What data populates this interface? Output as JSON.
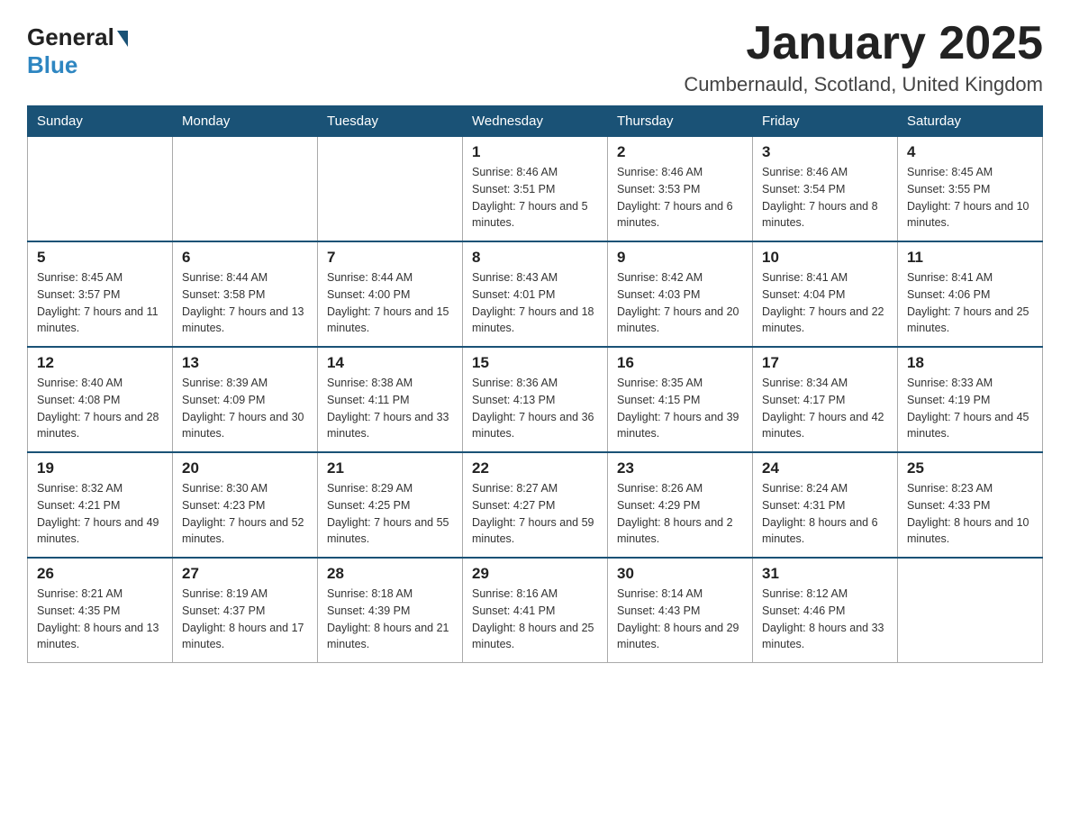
{
  "header": {
    "logo_general": "General",
    "logo_blue": "Blue",
    "month_title": "January 2025",
    "location": "Cumbernauld, Scotland, United Kingdom"
  },
  "weekdays": [
    "Sunday",
    "Monday",
    "Tuesday",
    "Wednesday",
    "Thursday",
    "Friday",
    "Saturday"
  ],
  "weeks": [
    [
      {
        "day": "",
        "info": ""
      },
      {
        "day": "",
        "info": ""
      },
      {
        "day": "",
        "info": ""
      },
      {
        "day": "1",
        "info": "Sunrise: 8:46 AM\nSunset: 3:51 PM\nDaylight: 7 hours and 5 minutes."
      },
      {
        "day": "2",
        "info": "Sunrise: 8:46 AM\nSunset: 3:53 PM\nDaylight: 7 hours and 6 minutes."
      },
      {
        "day": "3",
        "info": "Sunrise: 8:46 AM\nSunset: 3:54 PM\nDaylight: 7 hours and 8 minutes."
      },
      {
        "day": "4",
        "info": "Sunrise: 8:45 AM\nSunset: 3:55 PM\nDaylight: 7 hours and 10 minutes."
      }
    ],
    [
      {
        "day": "5",
        "info": "Sunrise: 8:45 AM\nSunset: 3:57 PM\nDaylight: 7 hours and 11 minutes."
      },
      {
        "day": "6",
        "info": "Sunrise: 8:44 AM\nSunset: 3:58 PM\nDaylight: 7 hours and 13 minutes."
      },
      {
        "day": "7",
        "info": "Sunrise: 8:44 AM\nSunset: 4:00 PM\nDaylight: 7 hours and 15 minutes."
      },
      {
        "day": "8",
        "info": "Sunrise: 8:43 AM\nSunset: 4:01 PM\nDaylight: 7 hours and 18 minutes."
      },
      {
        "day": "9",
        "info": "Sunrise: 8:42 AM\nSunset: 4:03 PM\nDaylight: 7 hours and 20 minutes."
      },
      {
        "day": "10",
        "info": "Sunrise: 8:41 AM\nSunset: 4:04 PM\nDaylight: 7 hours and 22 minutes."
      },
      {
        "day": "11",
        "info": "Sunrise: 8:41 AM\nSunset: 4:06 PM\nDaylight: 7 hours and 25 minutes."
      }
    ],
    [
      {
        "day": "12",
        "info": "Sunrise: 8:40 AM\nSunset: 4:08 PM\nDaylight: 7 hours and 28 minutes."
      },
      {
        "day": "13",
        "info": "Sunrise: 8:39 AM\nSunset: 4:09 PM\nDaylight: 7 hours and 30 minutes."
      },
      {
        "day": "14",
        "info": "Sunrise: 8:38 AM\nSunset: 4:11 PM\nDaylight: 7 hours and 33 minutes."
      },
      {
        "day": "15",
        "info": "Sunrise: 8:36 AM\nSunset: 4:13 PM\nDaylight: 7 hours and 36 minutes."
      },
      {
        "day": "16",
        "info": "Sunrise: 8:35 AM\nSunset: 4:15 PM\nDaylight: 7 hours and 39 minutes."
      },
      {
        "day": "17",
        "info": "Sunrise: 8:34 AM\nSunset: 4:17 PM\nDaylight: 7 hours and 42 minutes."
      },
      {
        "day": "18",
        "info": "Sunrise: 8:33 AM\nSunset: 4:19 PM\nDaylight: 7 hours and 45 minutes."
      }
    ],
    [
      {
        "day": "19",
        "info": "Sunrise: 8:32 AM\nSunset: 4:21 PM\nDaylight: 7 hours and 49 minutes."
      },
      {
        "day": "20",
        "info": "Sunrise: 8:30 AM\nSunset: 4:23 PM\nDaylight: 7 hours and 52 minutes."
      },
      {
        "day": "21",
        "info": "Sunrise: 8:29 AM\nSunset: 4:25 PM\nDaylight: 7 hours and 55 minutes."
      },
      {
        "day": "22",
        "info": "Sunrise: 8:27 AM\nSunset: 4:27 PM\nDaylight: 7 hours and 59 minutes."
      },
      {
        "day": "23",
        "info": "Sunrise: 8:26 AM\nSunset: 4:29 PM\nDaylight: 8 hours and 2 minutes."
      },
      {
        "day": "24",
        "info": "Sunrise: 8:24 AM\nSunset: 4:31 PM\nDaylight: 8 hours and 6 minutes."
      },
      {
        "day": "25",
        "info": "Sunrise: 8:23 AM\nSunset: 4:33 PM\nDaylight: 8 hours and 10 minutes."
      }
    ],
    [
      {
        "day": "26",
        "info": "Sunrise: 8:21 AM\nSunset: 4:35 PM\nDaylight: 8 hours and 13 minutes."
      },
      {
        "day": "27",
        "info": "Sunrise: 8:19 AM\nSunset: 4:37 PM\nDaylight: 8 hours and 17 minutes."
      },
      {
        "day": "28",
        "info": "Sunrise: 8:18 AM\nSunset: 4:39 PM\nDaylight: 8 hours and 21 minutes."
      },
      {
        "day": "29",
        "info": "Sunrise: 8:16 AM\nSunset: 4:41 PM\nDaylight: 8 hours and 25 minutes."
      },
      {
        "day": "30",
        "info": "Sunrise: 8:14 AM\nSunset: 4:43 PM\nDaylight: 8 hours and 29 minutes."
      },
      {
        "day": "31",
        "info": "Sunrise: 8:12 AM\nSunset: 4:46 PM\nDaylight: 8 hours and 33 minutes."
      },
      {
        "day": "",
        "info": ""
      }
    ]
  ]
}
